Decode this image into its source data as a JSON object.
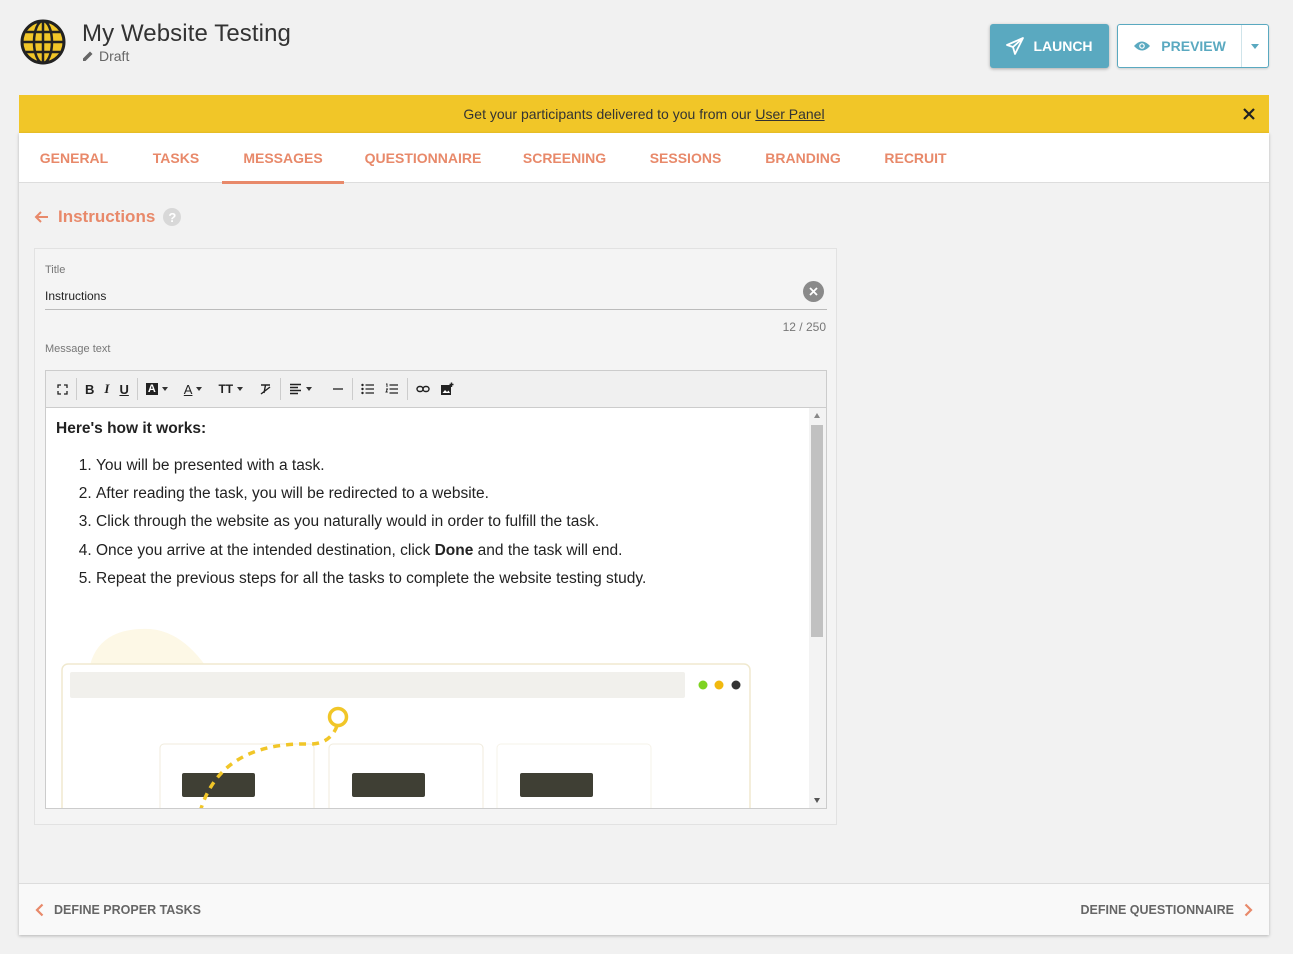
{
  "header": {
    "app_title": "My Website Testing",
    "status": "Draft",
    "launch_label": "LAUNCH",
    "preview_label": "PREVIEW",
    "accent_color": "#5aa9c0"
  },
  "banner": {
    "text": "Get your participants delivered to you from our",
    "link_text": "User Panel",
    "color": "#f1c628"
  },
  "tabs": [
    {
      "label": "GENERAL",
      "active": false
    },
    {
      "label": "TASKS",
      "active": false
    },
    {
      "label": "MESSAGES",
      "active": true
    },
    {
      "label": "QUESTIONNAIRE",
      "active": false
    },
    {
      "label": "SCREENING",
      "active": false
    },
    {
      "label": "SESSIONS",
      "active": false
    },
    {
      "label": "BRANDING",
      "active": false
    },
    {
      "label": "RECRUIT",
      "active": false
    }
  ],
  "section": {
    "title": "Instructions",
    "help": "?"
  },
  "form": {
    "title_label": "Title",
    "title_value": "Instructions",
    "char_count": "12 / 250",
    "message_label": "Message text"
  },
  "editor": {
    "heading": "Here's how it works:",
    "steps": [
      {
        "before": "You will be presented with a task.",
        "bold": "",
        "after": ""
      },
      {
        "before": "After reading the task, you will be redirected to a website.",
        "bold": "",
        "after": ""
      },
      {
        "before": "Click through the website as you naturally would in order to fulfill the task.",
        "bold": "",
        "after": ""
      },
      {
        "before": "Once you arrive at the intended destination, click ",
        "bold": "Done",
        "after": " and the task will end."
      },
      {
        "before": "Repeat the previous steps for all the tasks to complete the website testing study.",
        "bold": "",
        "after": ""
      }
    ]
  },
  "footer": {
    "prev_label": "DEFINE PROPER TASKS",
    "next_label": "DEFINE QUESTIONNAIRE"
  }
}
